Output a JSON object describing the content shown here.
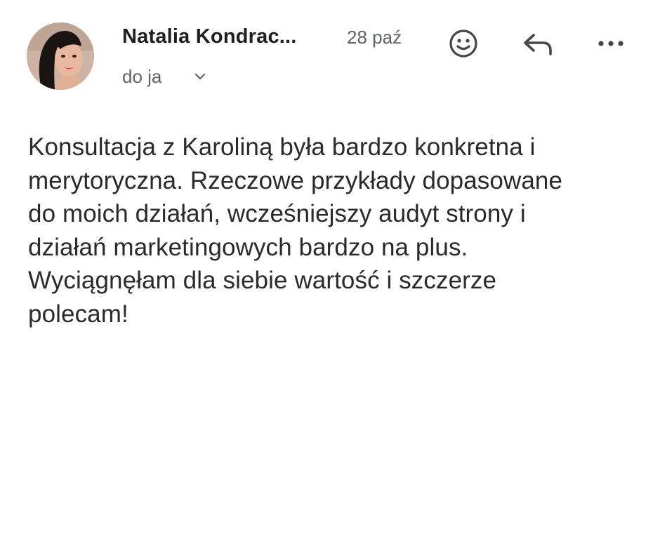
{
  "message": {
    "sender_name": "Natalia Kondrac...",
    "date": "28 paź",
    "recipient": "do ja",
    "body": "Konsultacja z Karoliną była bardzo konkretna i\nmerytoryczna. Rzeczowe przykłady dopasowane\ndo moich działań, wcześniejszy audyt strony i\ndziałań marketingowych bardzo na plus.\nWyciągnęłam dla siebie wartość i szczerze\npolecam!"
  },
  "icons": {
    "details_toggle": "chevron-down-icon",
    "react": "emoji-smile-icon",
    "reply": "reply-arrow-icon",
    "more": "more-horizontal-icon"
  },
  "colors": {
    "primary_text": "#1f1f1f",
    "secondary_text": "#5f6368",
    "icon": "#444746",
    "background": "#ffffff"
  }
}
